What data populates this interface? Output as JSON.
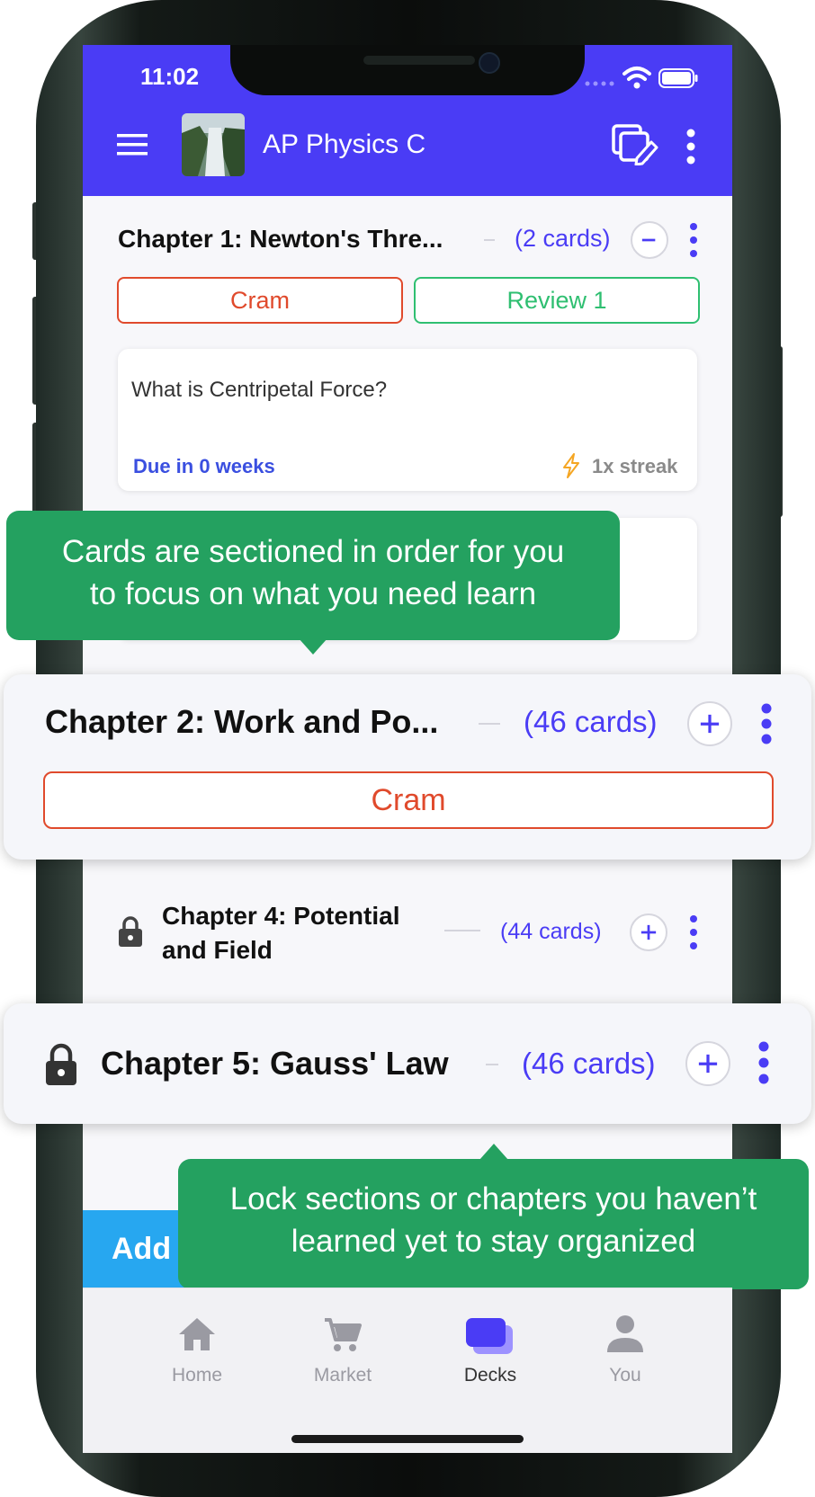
{
  "status_bar": {
    "time": "11:02"
  },
  "app_bar": {
    "title": "AP Physics C"
  },
  "chapters": [
    {
      "title": "Chapter 1: Newton's Thre...",
      "count": "(2 cards)",
      "cram_label": "Cram",
      "review_label": "Review 1"
    },
    {
      "title": "Chapter 2: Work and Po...",
      "count": "(46 cards)",
      "cram_label": "Cram"
    },
    {
      "title_line1": "Chapter 4: Potential",
      "title_line2": "and Field",
      "count": "(44 cards)"
    },
    {
      "title": "Chapter 5: Gauss' Law",
      "count": "(46 cards)"
    }
  ],
  "card": {
    "question": "What is Centripetal Force?",
    "due": "Due in 0 weeks",
    "streak": "1x streak"
  },
  "tooltips": [
    {
      "line1": "Cards are sectioned in order for you",
      "line2": "to focus on what you need learn"
    },
    {
      "line1": "Lock sections or chapters you haven’t",
      "line2": "learned yet to stay organized"
    }
  ],
  "add_button": {
    "label": "Add"
  },
  "bottom_nav": {
    "items": [
      {
        "label": "Home",
        "icon": "home-icon"
      },
      {
        "label": "Market",
        "icon": "cart-icon"
      },
      {
        "label": "Decks",
        "icon": "decks-icon"
      },
      {
        "label": "You",
        "icon": "person-icon"
      }
    ],
    "active": "Decks"
  },
  "colors": {
    "brand": "#4a3cf5",
    "cram": "#e04a2c",
    "review": "#2fbf71",
    "tooltip": "#24a160",
    "add_bar": "#27a7f0"
  }
}
